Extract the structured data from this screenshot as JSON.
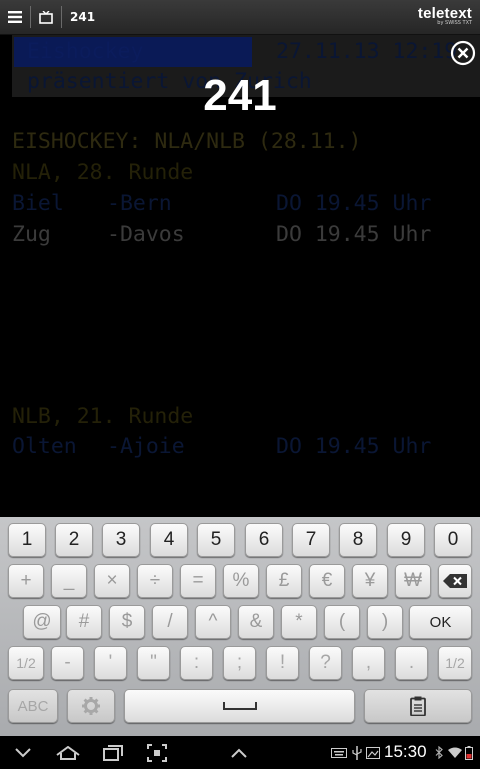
{
  "app_bar": {
    "menu_icon": "hamburger-menu-icon",
    "tv_icon": "tv-icon",
    "page_number": "241",
    "brand_name": "teletext",
    "brand_sub": "by SWISS TXT"
  },
  "teletext": {
    "header_title": " Eishockey",
    "header_datetime": "27.11.13 12:19",
    "header_sponsor": " präsentiert von Zurich",
    "overlay_page_number": "241",
    "heading": "EISHOCKEY: NLA/NLB (28.11.)",
    "nla_round": "NLA, 28. Runde",
    "nla_games": [
      {
        "home": "Biel",
        "away": "-Bern",
        "time": "DO 19.45 Uhr"
      },
      {
        "home": "Zug",
        "away": "-Davos",
        "time": "DO 19.45 Uhr"
      }
    ],
    "nlb_round": "NLB, 21. Runde",
    "nlb_games": [
      {
        "home": "Olten",
        "away": "-Ajoie",
        "time": "DO 19.45 Uhr"
      }
    ]
  },
  "keyboard": {
    "row1": [
      "1",
      "2",
      "3",
      "4",
      "5",
      "6",
      "7",
      "8",
      "9",
      "0"
    ],
    "row2": [
      "+",
      "_",
      "×",
      "÷",
      "=",
      "%",
      "£",
      "€",
      "¥",
      "₩"
    ],
    "row3": [
      "@",
      "#",
      "$",
      "/",
      "^",
      "&",
      "*",
      "(",
      ")"
    ],
    "ok": "OK",
    "row4": [
      "1/2",
      "-",
      "'",
      "\"",
      ":",
      ";",
      "!",
      "?",
      ",",
      ".",
      "1/2"
    ],
    "abc": "ABC"
  },
  "status_bar": {
    "time": "15:30"
  },
  "colors": {
    "teletext_blue_bg": "#0a1a56",
    "teletext_yellow": "#2e2a10",
    "keyboard_bg": "#b8b9bb"
  }
}
